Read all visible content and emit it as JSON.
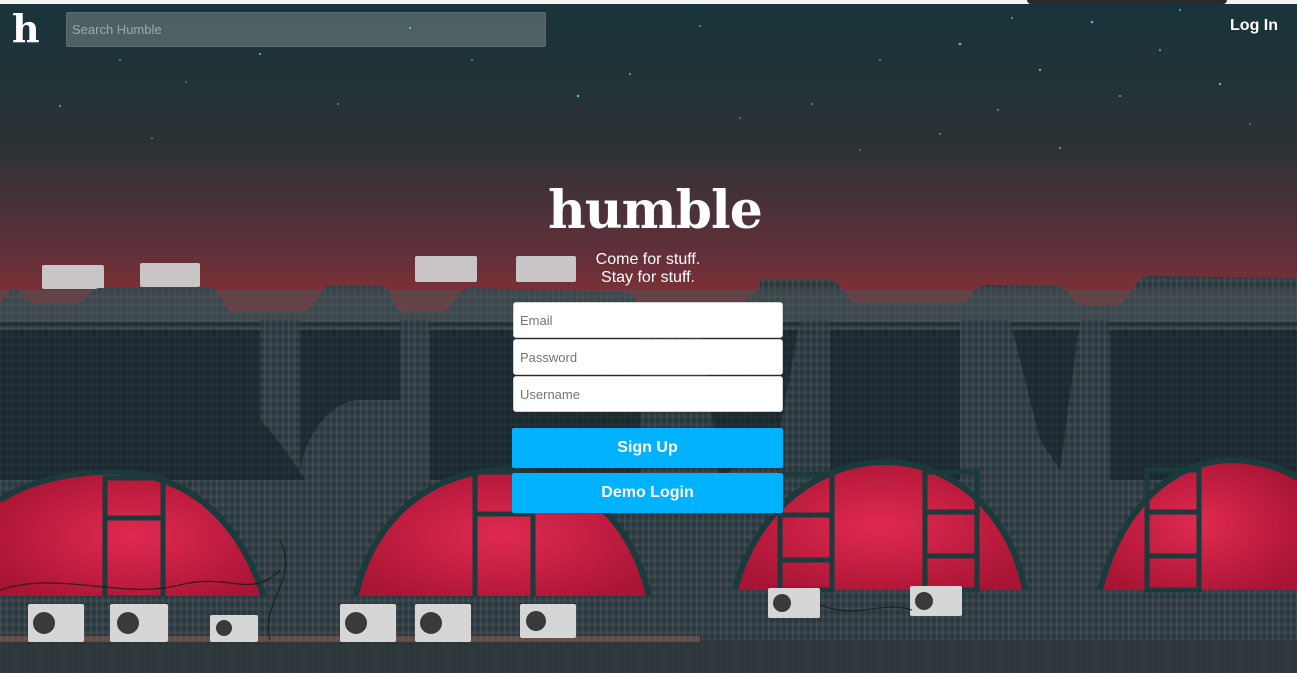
{
  "header": {
    "logo": "h",
    "search_placeholder": "Search Humble",
    "login_label": "Log In"
  },
  "hero": {
    "brand": "humble",
    "tagline_1": "Come for stuff.",
    "tagline_2": "Stay for stuff."
  },
  "form": {
    "email_placeholder": "Email",
    "password_placeholder": "Password",
    "username_placeholder": "Username",
    "signup_label": "Sign Up",
    "demo_label": "Demo Login"
  },
  "colors": {
    "accent": "#00b2ff",
    "window_red": "#c8183e",
    "sky_top": "#17343a",
    "sky_bottom": "#9c3030"
  }
}
